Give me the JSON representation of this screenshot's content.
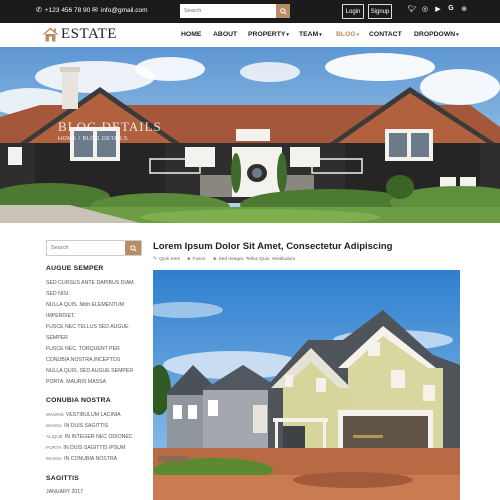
{
  "topbar": {
    "phone": "+123 456 78 90",
    "email": "info@gmail.com",
    "search_placeholder": "Search",
    "login": "Login",
    "signup": "Signup",
    "social": [
      "twitter-icon",
      "instagram-icon",
      "youtube-icon",
      "google-icon",
      "dribbble-icon"
    ]
  },
  "nav": {
    "logo": "ESTATE",
    "items": [
      {
        "label": "HOME",
        "dropdown": false
      },
      {
        "label": "ABOUT",
        "dropdown": false
      },
      {
        "label": "PROPERTY",
        "dropdown": true
      },
      {
        "label": "TEAM",
        "dropdown": true
      },
      {
        "label": "BLOG",
        "dropdown": true,
        "active": true
      },
      {
        "label": "CONTACT",
        "dropdown": false
      },
      {
        "label": "DROPDOWN",
        "dropdown": true
      }
    ],
    "caret": "▾"
  },
  "hero": {
    "title": "BLOG DETAILS",
    "breadcrumb": "HOME / BLOG DETAILS"
  },
  "sidebar": {
    "search_placeholder": "Search",
    "section1_title": "AUGUE SEMPER",
    "section1_links": [
      "SED CURSUS ANTE DAPIBUS DIAM.",
      "SED NISI.",
      "NULLA QUIS. Nibh ELEMENTUM",
      "IMPERDIET.",
      "FUSCE NEC TELLUS SED AUGUE",
      "SEMPER",
      "FUSCE NEC. TORQUENT PER",
      "CONUBIA NOSTRA,INCEPTOS",
      "NULLA QUIS. SED AUGUE SEMPER",
      "PORTA. MAURIS MASSA"
    ],
    "section2_title": "CONUBIA NOSTRA",
    "section2_links": [
      {
        "tag": "MAURIS",
        "text": "VESTIBULUM LACINIA"
      },
      {
        "tag": "MASSA",
        "text": "IN DUIS SAGITTIS"
      },
      {
        "tag": "ALIQUE",
        "text": "IN INTEGER NEC ODIONEC"
      },
      {
        "tag": "PORTA",
        "text": "IN DUIS SAGITTIS IPSUM"
      },
      {
        "tag": "MASSA",
        "text": "IN CONUBIA NOSTRA"
      }
    ],
    "section3_title": "SAGITTIS",
    "section3_links": [
      "JANUARY 2017"
    ]
  },
  "post": {
    "title": "Lorem Ipsum Dolor Sit Amet, Consectetur Adipiscing",
    "author": "Quis Sem",
    "category": "Fusce",
    "tags": "Sed Integer, Tellus Quis, Vestibulum"
  },
  "colors": {
    "accent": "#b98d62",
    "topbar_bg": "#1b1b1b",
    "text_dark": "#222222"
  }
}
